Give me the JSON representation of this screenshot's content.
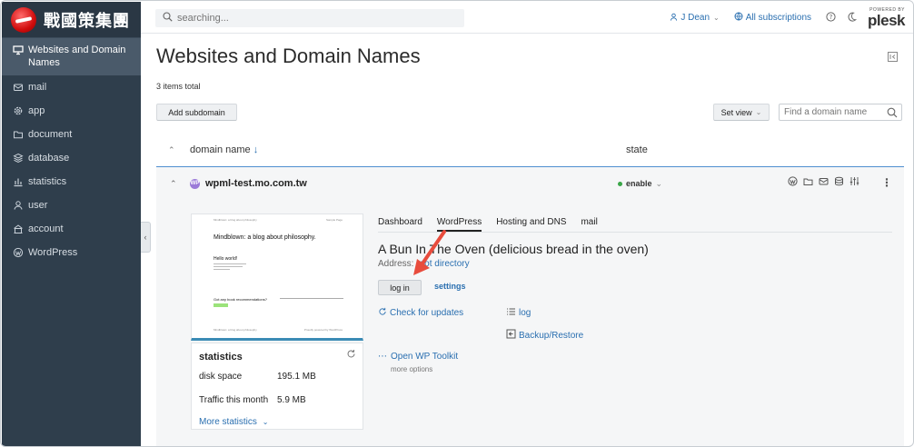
{
  "brand": {
    "logo_text": "戰國策集團"
  },
  "sidebar": {
    "items": [
      {
        "label": "Websites and Domain Names",
        "icon": "monitor-icon",
        "active": true
      },
      {
        "label": "mail",
        "icon": "mail-icon"
      },
      {
        "label": "app",
        "icon": "gear-icon"
      },
      {
        "label": "document",
        "icon": "folder-icon"
      },
      {
        "label": "database",
        "icon": "database-icon"
      },
      {
        "label": "statistics",
        "icon": "bar-chart-icon"
      },
      {
        "label": "user",
        "icon": "user-icon"
      },
      {
        "label": "account",
        "icon": "account-icon"
      },
      {
        "label": "WordPress",
        "icon": "wordpress-icon"
      }
    ]
  },
  "header": {
    "search_placeholder": "searching...",
    "user": "J Dean",
    "subscriptions": "All subscriptions",
    "plesk_top": "POWERED BY",
    "plesk_word": "plesk"
  },
  "page": {
    "title": "Websites and Domain Names",
    "items_total": "3 items total",
    "add_subdomain": "Add subdomain",
    "set_view": "Set view",
    "find_placeholder": "Find a domain name",
    "col_domain": "domain name",
    "col_domain_sort": "↓",
    "col_state": "state"
  },
  "domain": {
    "name": "wpml-test.mo.com.tw",
    "badge": "WP",
    "state": "enable"
  },
  "preview": {
    "top_left": "Mindblown: a blog about philosophy",
    "top_right": "Sample Page",
    "heading": "Mindblown: a blog about philosophy.",
    "hello": "Hello world!",
    "book": "Got any book recommendations?",
    "foot_left": "Mindblown: a blog about philosophy",
    "foot_right": "Proudly powered by WordPress"
  },
  "stats": {
    "title": "statistics",
    "disk_label": "disk space",
    "disk_value": "195.1 MB",
    "traffic_label": "Traffic this month",
    "traffic_value": "5.9 MB",
    "more": "More statistics"
  },
  "tabs": [
    {
      "label": "Dashboard"
    },
    {
      "label": "WordPress",
      "active": true
    },
    {
      "label": "Hosting and DNS"
    },
    {
      "label": "mail"
    }
  ],
  "wordpress": {
    "site_title": "A Bun In The Oven (delicious bread in the oven)",
    "address_label": "Address:",
    "address_value": "root directory",
    "login": "log in",
    "settings": "settings",
    "check_updates": "Check for updates",
    "log": "log",
    "backup": "Backup/Restore",
    "toolkit": "Open WP Toolkit",
    "more_options": "more options"
  },
  "colors": {
    "accent": "#2a6fb0",
    "sidebar": "#2f3e4c",
    "state_ok": "#3aa648",
    "arrow": "#e84c3d"
  }
}
